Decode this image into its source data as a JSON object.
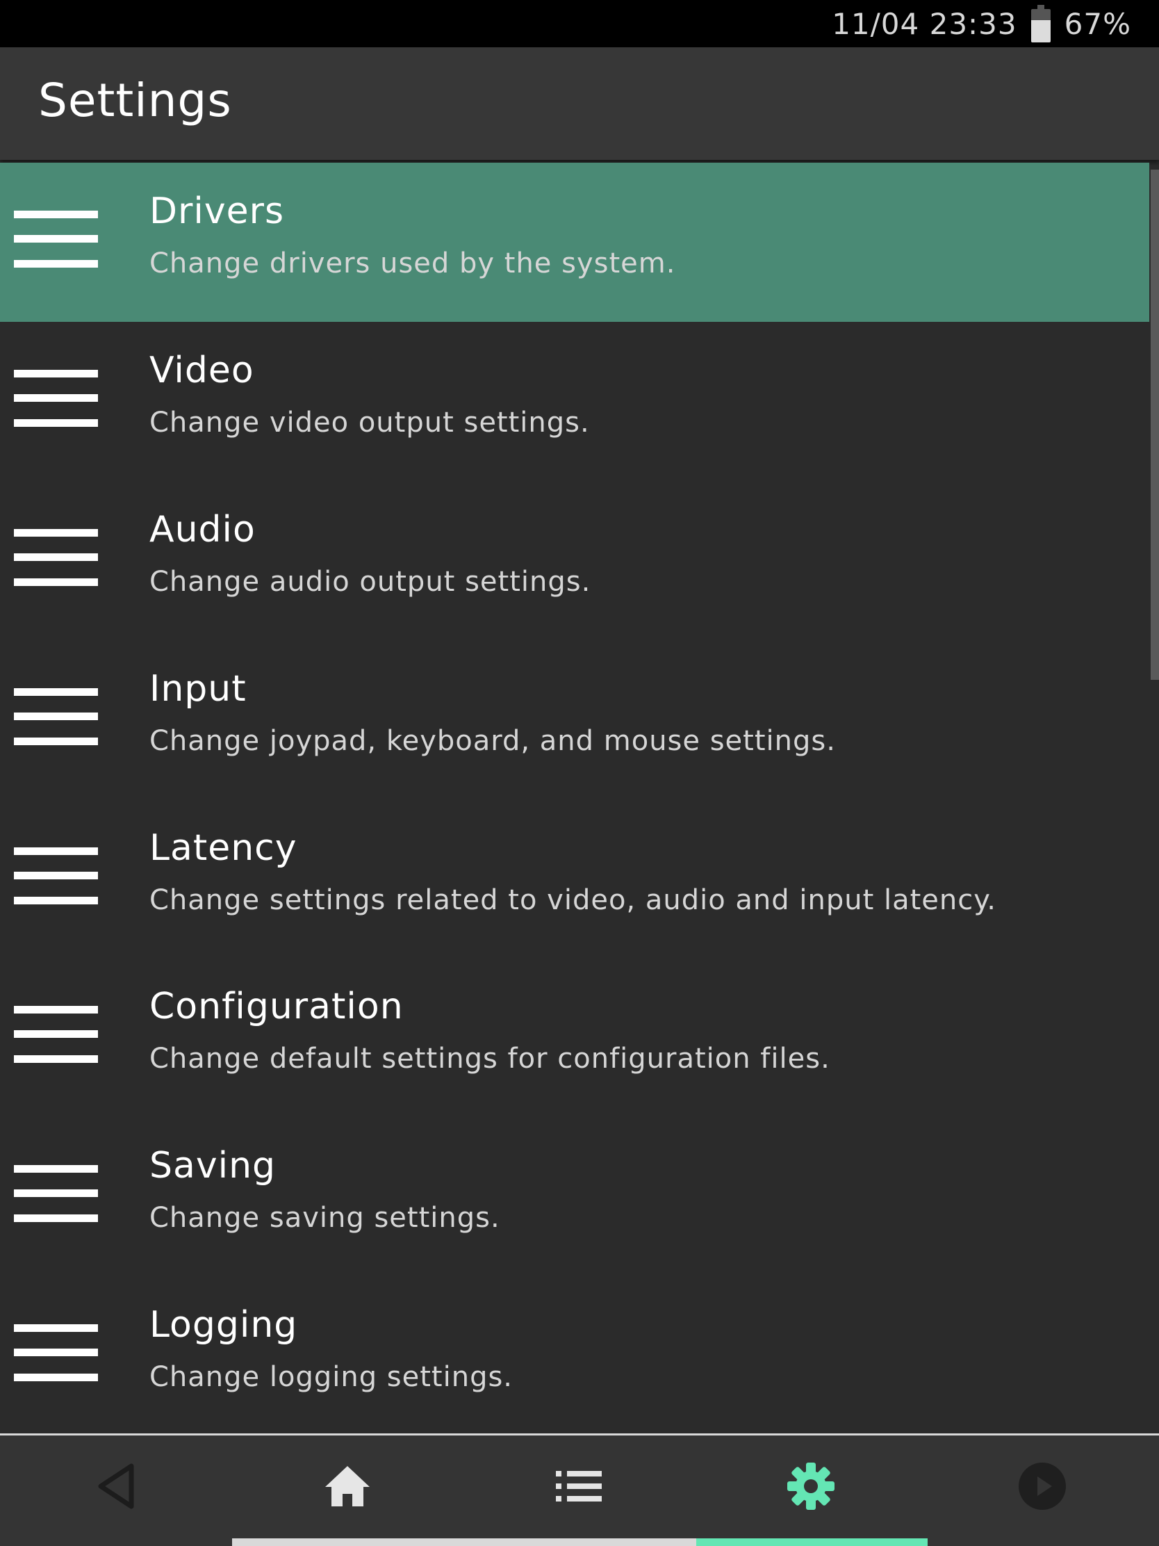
{
  "status_bar": {
    "datetime": "11/04 23:33",
    "battery": "67%"
  },
  "header": {
    "title": "Settings"
  },
  "menu_items": [
    {
      "label": "Drivers",
      "sublabel": "Change drivers used by the system.",
      "selected": true
    },
    {
      "label": "Video",
      "sublabel": "Change video output settings."
    },
    {
      "label": "Audio",
      "sublabel": "Change audio output settings."
    },
    {
      "label": "Input",
      "sublabel": "Change joypad, keyboard, and mouse settings."
    },
    {
      "label": "Latency",
      "sublabel": "Change settings related to video, audio and input latency."
    },
    {
      "label": "Configuration",
      "sublabel": "Change default settings for configuration files."
    },
    {
      "label": "Saving",
      "sublabel": "Change saving settings."
    },
    {
      "label": "Logging",
      "sublabel": "Change logging settings."
    }
  ],
  "bottom_nav": {
    "items": [
      {
        "icon": "back-icon"
      },
      {
        "icon": "home-icon"
      },
      {
        "icon": "playlist-icon"
      },
      {
        "icon": "settings-icon",
        "active": true
      },
      {
        "icon": "play-icon"
      }
    ]
  },
  "colors": {
    "accent": "#64e6b4",
    "selected_row": "#4a8a75",
    "background": "#2b2b2b",
    "header": "#373737"
  }
}
